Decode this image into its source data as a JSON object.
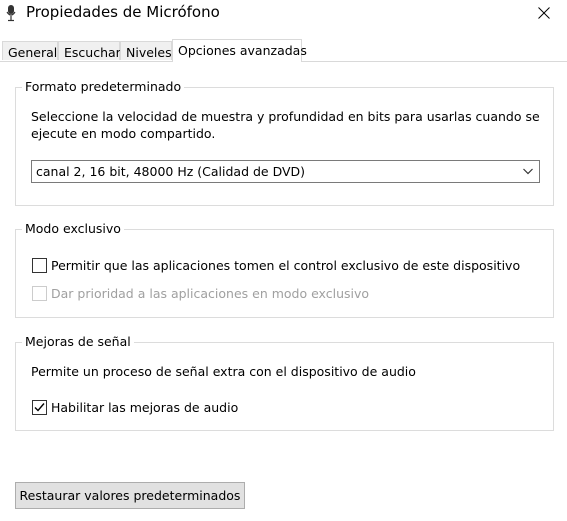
{
  "window": {
    "title": "Propiedades de Micrófono",
    "icon": "microphone-icon",
    "close_icon": "close-icon"
  },
  "tabs": [
    {
      "label": "General",
      "active": false
    },
    {
      "label": "Escuchar",
      "active": false
    },
    {
      "label": "Niveles",
      "active": false
    },
    {
      "label": "Opciones avanzadas",
      "active": true
    }
  ],
  "default_format": {
    "title": "Formato predeterminado",
    "description_line1": "Seleccione la velocidad de muestra y profundidad en bits para usarlas cuando se",
    "description_line2": "ejecute en modo compartido.",
    "selected_value": "canal 2, 16 bit, 48000 Hz (Calidad de DVD)"
  },
  "exclusive_mode": {
    "title": "Modo exclusivo",
    "allow_exclusive_label": "Permitir que las aplicaciones tomen el control exclusivo de este dispositivo",
    "allow_exclusive_checked": false,
    "priority_label": "Dar prioridad a las aplicaciones en modo exclusivo",
    "priority_checked": false,
    "priority_enabled": false
  },
  "signal_enhancements": {
    "title": "Mejoras de señal",
    "description": "Permite un proceso de señal extra con el dispositivo de audio",
    "enable_label": "Habilitar las mejoras de audio",
    "enable_checked": true
  },
  "restore_button_label": "Restaurar valores predeterminados"
}
